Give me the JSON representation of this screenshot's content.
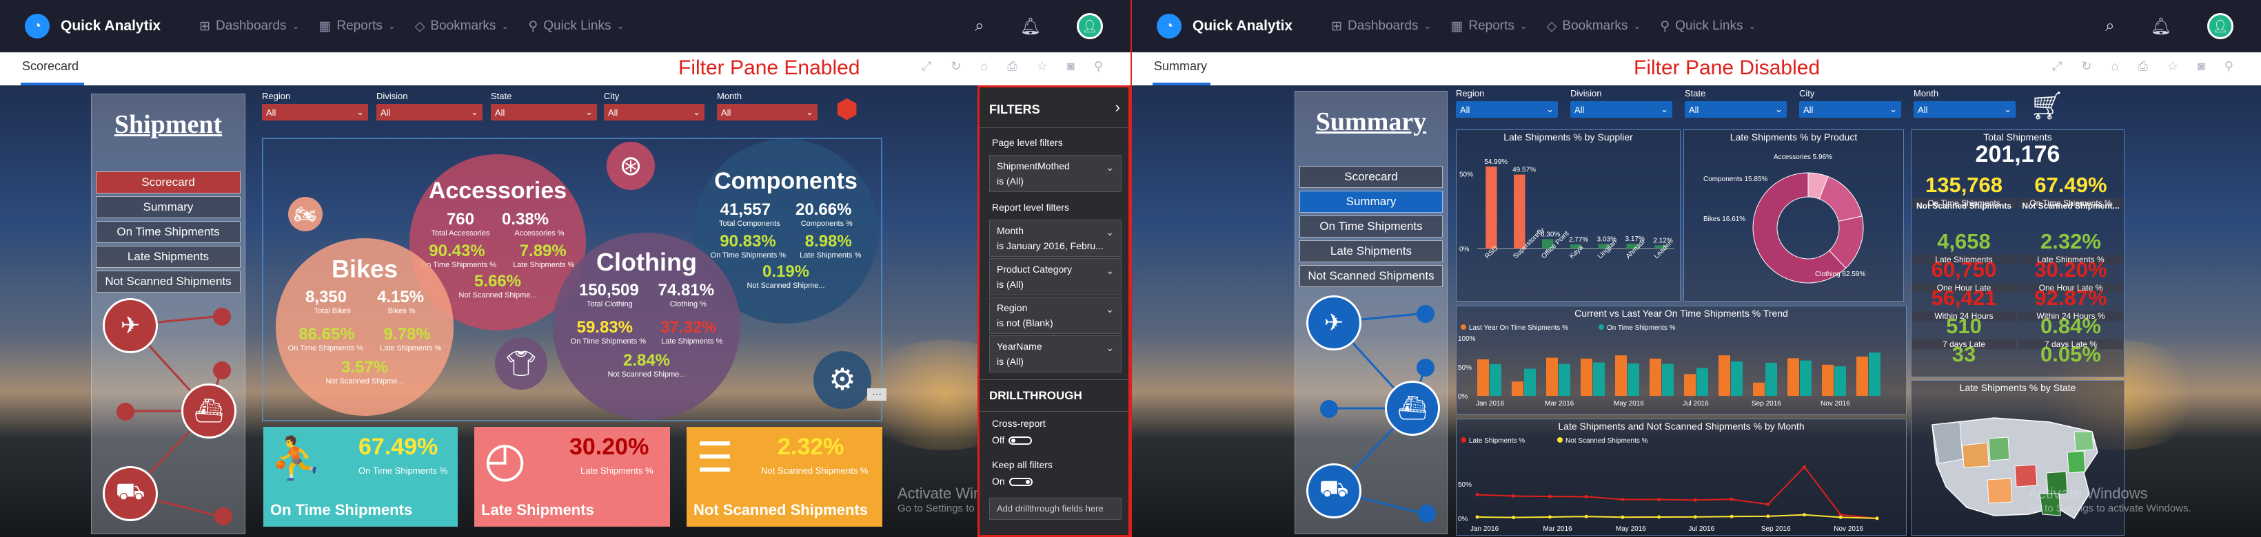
{
  "app": {
    "name": "Quick Analytix"
  },
  "nav": [
    {
      "label": "Dashboards",
      "icon": "dashboard-icon"
    },
    {
      "label": "Reports",
      "icon": "reports-icon"
    },
    {
      "label": "Bookmarks",
      "icon": "bookmark-icon"
    },
    {
      "label": "Quick Links",
      "icon": "link-icon"
    }
  ],
  "left": {
    "page_tab": "Scorecard",
    "banner": "Filter Pane Enabled",
    "title": "Shipment",
    "menu": [
      "Scorecard",
      "Summary",
      "On Time Shipments",
      "Late Shipments",
      "Not Scanned Shipments"
    ],
    "filters": [
      {
        "label": "Region",
        "value": "All"
      },
      {
        "label": "Division",
        "value": "All"
      },
      {
        "label": "State",
        "value": "All"
      },
      {
        "label": "City",
        "value": "All"
      },
      {
        "label": "Month",
        "value": "All"
      }
    ],
    "bubbles": {
      "accessories": {
        "title": "Accessories",
        "v1": "760",
        "v2": "0.38%",
        "l1": "Total Accessories",
        "l2": "Accessories %",
        "v3": "90.43%",
        "v4": "7.89%",
        "l3": "On Time Shipments %",
        "l4": "Late Shipments %",
        "v5": "5.66%",
        "l5": "Not Scanned Shipme..."
      },
      "components": {
        "title": "Components",
        "v1": "41,557",
        "v2": "20.66%",
        "l1": "Total Components",
        "l2": "Components %",
        "v3": "90.83%",
        "v4": "8.98%",
        "l3": "On Time Shipments %",
        "l4": "Late Shipments %",
        "v5": "0.19%",
        "l5": "Not Scanned Shipme..."
      },
      "bikes": {
        "title": "Bikes",
        "v1": "8,350",
        "v2": "4.15%",
        "l1": "Total Bikes",
        "l2": "Bikes %",
        "v3": "86.65%",
        "v4": "9.78%",
        "l3": "On Time Shipments %",
        "l4": "Late Shipments %",
        "v5": "3.57%",
        "l5": "Not Scanned Shipme..."
      },
      "clothing": {
        "title": "Clothing",
        "v1": "150,509",
        "v2": "74.81%",
        "l1": "Total Clothing",
        "l2": "Clothing %",
        "v3": "59.83%",
        "v4": "37.32%",
        "l3": "On Time Shipments %",
        "l4": "Late Shipments %",
        "v5": "2.84%",
        "l5": "Not Scanned Shipme..."
      }
    },
    "kpis": [
      {
        "value": "67.49%",
        "sub": "On Time Shipments %",
        "label": "On Time Shipments"
      },
      {
        "value": "30.20%",
        "sub": "Late Shipments %",
        "label": "Late Shipments"
      },
      {
        "value": "2.32%",
        "sub": "Not Scanned Shipments %",
        "label": "Not Scanned Shipments"
      }
    ],
    "filter_pane": {
      "header": "FILTERS",
      "page_level": "Page level filters",
      "report_level": "Report level filters",
      "page_cards": [
        {
          "name": "ShipmentMothed",
          "value": "is (All)"
        }
      ],
      "report_cards": [
        {
          "name": "Month",
          "value": "is January 2016, Febru..."
        },
        {
          "name": "Product Category",
          "value": "is (All)"
        },
        {
          "name": "Region",
          "value": "is not (Blank)"
        },
        {
          "name": "YearName",
          "value": "is (All)"
        }
      ],
      "drillthrough": "DRILLTHROUGH",
      "cross_report": "Cross-report",
      "cross_state": "Off",
      "keep_all": "Keep all filters",
      "keep_state": "On",
      "add_fields": "Add drillthrough fields here"
    },
    "watermark1": "Activate Windows",
    "watermark2": "Go to Settings to activate Windows."
  },
  "right": {
    "page_tab": "Summary",
    "banner": "Filter Pane Disabled",
    "title": "Summary",
    "menu": [
      "Scorecard",
      "Summary",
      "On Time Shipments",
      "Late Shipments",
      "Not Scanned Shipments"
    ],
    "filters": [
      {
        "label": "Region",
        "value": "All"
      },
      {
        "label": "Division",
        "value": "All"
      },
      {
        "label": "State",
        "value": "All"
      },
      {
        "label": "City",
        "value": "All"
      },
      {
        "label": "Month",
        "value": "All"
      }
    ],
    "tiles": {
      "by_supplier": "Late Shipments % by Supplier",
      "by_product": "Late Shipments % by Product",
      "trend": "Current vs Last Year On Time Shipments % Trend",
      "by_month": "Late Shipments and Not Scanned Shipments % by Month",
      "total": "Total Shipments",
      "by_state": "Late Shipments % by State"
    },
    "total_shipments": "201,176",
    "stats": [
      {
        "value": "135,768",
        "label": "On Time Shipments",
        "color": "#ffe633"
      },
      {
        "value": "67.49%",
        "label": "On Time Shipments %",
        "color": "#ffe633"
      },
      {
        "value": "Not Scanned Shipments",
        "label": "",
        "color": "#ffffff"
      },
      {
        "value": "Not Scanned Shipment...",
        "label": "",
        "color": "#ffffff"
      },
      {
        "value": "4,658",
        "label": "Late Shipments",
        "color": "#8dc63f"
      },
      {
        "value": "2.32%",
        "label": "Late Shipments %",
        "color": "#8dc63f"
      },
      {
        "value": "60,750",
        "label": "One Hour Late",
        "color": "#e0201a"
      },
      {
        "value": "30.20%",
        "label": "One Hour Late %",
        "color": "#e0201a"
      },
      {
        "value": "56,421",
        "label": "Within 24 Hours",
        "color": "#e0201a"
      },
      {
        "value": "92.87%",
        "label": "Within 24 Hours %",
        "color": "#e0201a"
      },
      {
        "value": "510",
        "label": "7 days Late",
        "color": "#8dc63f"
      },
      {
        "value": "0.84%",
        "label": "7 days Late %",
        "color": "#8dc63f"
      },
      {
        "value": "33",
        "label": "",
        "color": "#8dc63f"
      },
      {
        "value": "0.05%",
        "label": "",
        "color": "#8dc63f"
      }
    ],
    "watermark1": "Activate Windows",
    "watermark2": "Go to Settings to activate Windows."
  },
  "chart_data": [
    {
      "type": "bar",
      "title": "Late Shipments % by Supplier",
      "categories": [
        "RSD",
        "Superstorefly",
        "Office Point",
        "Kaya",
        "Lingjian",
        "Ahmadi",
        "Leader"
      ],
      "values": [
        54.99,
        49.57,
        6.3,
        2.77,
        3.03,
        3.17,
        2.12
      ],
      "data_labels": [
        "54.99%",
        "49.57%",
        "6.30%",
        "2.77%",
        "3.03%",
        "3.17%",
        "2.12%"
      ],
      "ylim": [
        0,
        60
      ]
    },
    {
      "type": "pie",
      "title": "Late Shipments % by Product",
      "categories": [
        "Accessories",
        "Components",
        "Bikes",
        "Clothing"
      ],
      "values": [
        5.96,
        15.85,
        16.61,
        62.59
      ],
      "data_labels": [
        "Accessories 5.96%",
        "Components 15.85%",
        "Bikes 16.61%",
        "Clothing 62.59%"
      ]
    },
    {
      "type": "bar",
      "title": "Current vs Last Year On Time Shipments % Trend",
      "x_ticks": [
        "Jan 2016",
        "Mar 2016",
        "May 2016",
        "Jul 2016",
        "Sep 2016",
        "Nov 2016"
      ],
      "series": [
        {
          "name": "Last Year On Time Shipments %",
          "color": "#f07a2a",
          "values": [
            63.13,
            24.67,
            66.01,
            64.47,
            69.99,
            64.47,
            37.59,
            70.08,
            22.94,
            65.05,
            53.76,
            67.95
          ]
        },
        {
          "name": "On Time Shipments %",
          "color": "#12a59a",
          "values": [
            54.76,
            46.99,
            55.24,
            57.71,
            55.92,
            55.43,
            48.12,
            59.52,
            57.24,
            61.17,
            51.07,
            74.95
          ]
        }
      ],
      "ylim": [
        0,
        100
      ]
    },
    {
      "type": "line",
      "title": "Late Shipments and Not Scanned Shipments % by Month",
      "x_ticks": [
        "Jan 2016",
        "Mar 2016",
        "May 2016",
        "Jul 2016",
        "Sep 2016",
        "Nov 2016"
      ],
      "series": [
        {
          "name": "Late Shipments %",
          "color": "#e0201a",
          "values": [
            34.39,
            32.55,
            31.86,
            31.61,
            27.5,
            27.5,
            26.69,
            27.78,
            20.48,
            74.68,
            5.26,
            0.0
          ]
        },
        {
          "name": "Not Scanned Shipments %",
          "color": "#ffe633",
          "values": [
            2.0,
            1.34,
            2.0,
            2.78,
            1.75,
            2.0,
            2.12,
            2.77,
            3.12,
            5.26,
            1.6,
            0.09
          ]
        }
      ],
      "ylim": [
        0,
        100
      ]
    }
  ]
}
